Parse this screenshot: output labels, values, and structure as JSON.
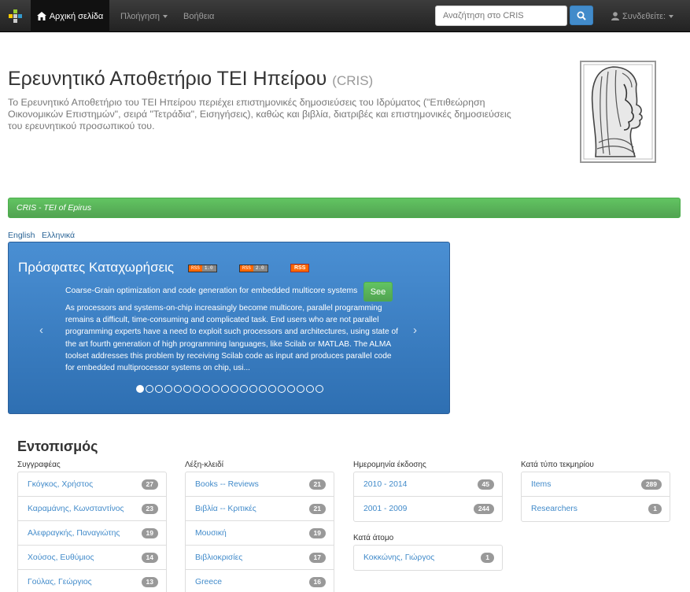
{
  "navbar": {
    "home": "Αρχική σελίδα",
    "browse": "Πλοήγηση",
    "help": "Βοήθεια",
    "search_placeholder": "Αναζήτηση στο CRIS",
    "login": "Συνδεθείτε:"
  },
  "hero": {
    "title": "Ερευνητικό Αποθετήριο ΤΕΙ Ηπείρου",
    "title_small": "(CRIS)",
    "description": "Το Ερευνητικό Αποθετήριο του ΤΕΙ Ηπείρου περιέχει επιστημονικές δημοσιεύσεις του Ιδρύματος (\"Επιθεώρηση Οικονομικών Επιστημών\", σειρά \"Τετράδια\", Εισηγήσεις), καθώς και βιβλία, διατριβές και επιστημονικές δημοσιεύσεις του ερευνητικού προσωπικού του."
  },
  "banner": {
    "text": "CRIS - TEI of Epirus"
  },
  "languages": {
    "english": "English",
    "greek": "Ελληνικά"
  },
  "recent": {
    "title": "Πρόσφατες Καταχωρήσεις",
    "rss1": {
      "left": "RSS",
      "right": "1.0"
    },
    "rss2": {
      "left": "RSS",
      "right": "2.0"
    },
    "rss3": "RSS",
    "item_title": "Coarse-Grain optimization and code generation for embedded multicore systems",
    "see": "See",
    "abstract": "As processors and systems-on-chip increasingly become multicore, parallel programming remains a difficult, time-consuming and complicated task. End users who are not parallel programming experts have a need to exploit such processors and architectures, using state of the art fourth generation of high programming languages, like Scilab or MATLAB. The ALMA toolset addresses this problem by receiving Scilab code as input and produces parallel code for embedded multiprocessor systems on chip, usi...",
    "slide_count": 20,
    "active_slide": 0
  },
  "browse": {
    "title": "Εντοπισμός",
    "authors": {
      "label": "Συγγραφέας",
      "items": [
        {
          "text": "Γκόγκος, Χρήστος",
          "count": "27"
        },
        {
          "text": "Καραμάνης, Κωνσταντίνος",
          "count": "23"
        },
        {
          "text": "Αλεφραγκής, Παναγιώτης",
          "count": "19"
        },
        {
          "text": "Χούσος, Ευθύμιος",
          "count": "14"
        },
        {
          "text": "Γούλας, Γεώργιος",
          "count": "13"
        }
      ]
    },
    "keywords": {
      "label": "Λέξη-κλειδί",
      "items": [
        {
          "text": "Books -- Reviews",
          "count": "21"
        },
        {
          "text": "Βιβλία -- Κριτικές",
          "count": "21"
        },
        {
          "text": "Μουσική",
          "count": "19"
        },
        {
          "text": "Βιβλιοκρισίες",
          "count": "17"
        },
        {
          "text": "Greece",
          "count": "16"
        }
      ]
    },
    "dates": {
      "label": "Ημερομηνία έκδοσης",
      "items": [
        {
          "text": "2010 - 2014",
          "count": "45"
        },
        {
          "text": "2001 - 2009",
          "count": "244"
        }
      ]
    },
    "person": {
      "label": "Κατά άτομο",
      "items": [
        {
          "text": "Κοκκώνης, Γιώργος",
          "count": "1"
        }
      ]
    },
    "types": {
      "label": "Κατά τύπο τεκμηρίου",
      "items": [
        {
          "text": "Items",
          "count": "289"
        },
        {
          "text": "Researchers",
          "count": "1"
        }
      ]
    }
  },
  "colors": {
    "navbar": "#222222",
    "link": "#428bca",
    "green": "#5cb85c",
    "carousel": "#3a7fc4",
    "badge": "#999999"
  },
  "icons": [
    "dspace-logo-icon",
    "home-icon",
    "search-icon",
    "user-icon",
    "chevron-left-icon",
    "chevron-right-icon"
  ]
}
